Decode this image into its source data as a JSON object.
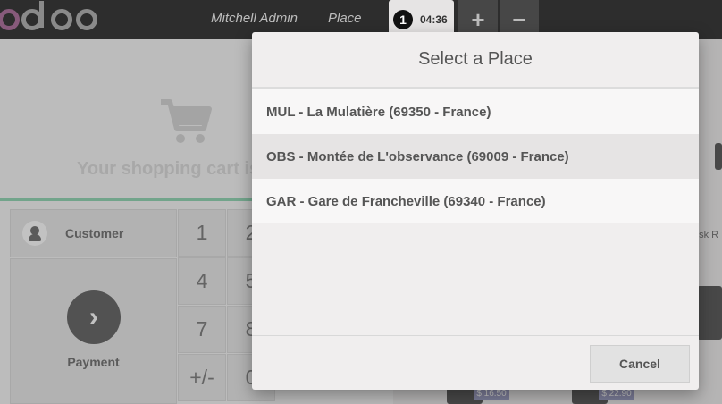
{
  "topbar": {
    "user": "Mitchell Admin",
    "place": "Place",
    "order_number": "1",
    "order_time": "04:36",
    "add_label": "+",
    "remove_label": "−"
  },
  "cart": {
    "empty_text": "Your shopping cart is e"
  },
  "controls": {
    "customer_label": "Customer",
    "payment_label": "Payment",
    "keys": [
      "1",
      "2",
      "4",
      "5",
      "7",
      "8",
      "+/-",
      "0"
    ]
  },
  "products": {
    "partial_label": "esk R",
    "prices": [
      "$ 16.50",
      "$ 22.90"
    ]
  },
  "modal": {
    "title": "Select a Place",
    "places": [
      "MUL - La Mulatière (69350 - France)",
      "OBS - Montée de L'observance (69009 - France)",
      "GAR - Gare de Francheville (69340 - France)"
    ],
    "cancel_label": "Cancel"
  },
  "colors": {
    "brand": "#875a7b",
    "accent_green": "#6ec89b",
    "price_tag": "#7d7fb0"
  }
}
